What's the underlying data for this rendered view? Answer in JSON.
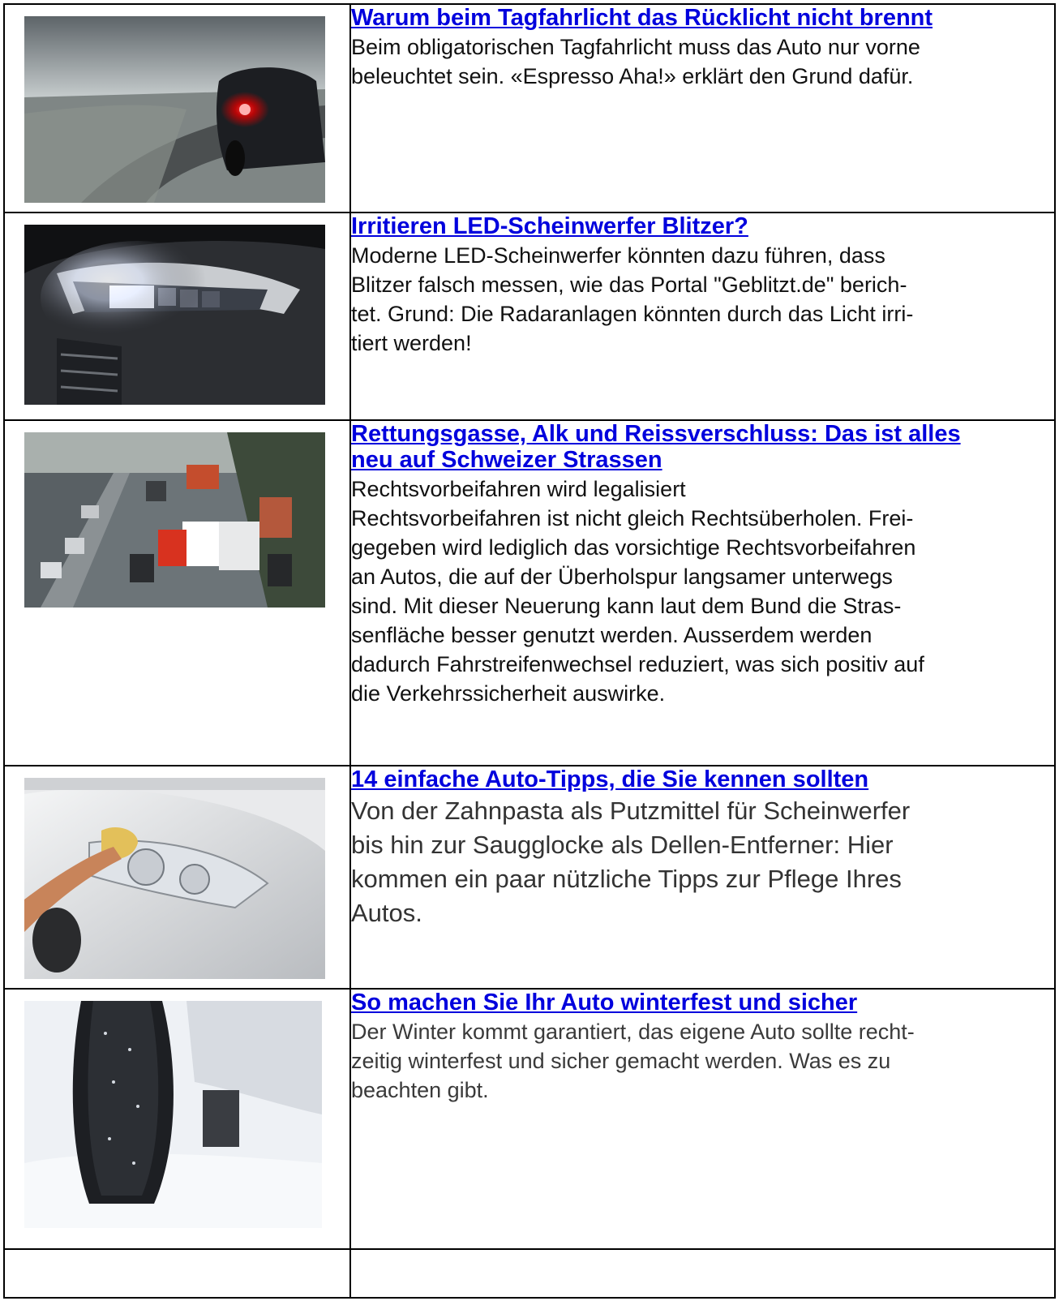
{
  "articles": [
    {
      "title": "Warum beim Tagfahrlicht das Rücklicht nicht brennt",
      "lines": [
        "Beim obligatorischen Tagfahrlicht muss das Auto nur vorne",
        "beleuchtet sein. «Espresso Aha!» erklärt den Grund dafür."
      ]
    },
    {
      "title": "Irritieren LED-Scheinwerfer Blitzer?",
      "lines": [
        "Moderne LED-Scheinwerfer könnten dazu führen, dass",
        "Blitzer falsch messen, wie das Portal \"Geblitzt.de\" berich-",
        "tet. Grund: Die Radaranlagen könnten durch das Licht irri-",
        "tiert werden!"
      ]
    },
    {
      "title_lines": [
        "Rettungsgasse, Alk und Reissverschluss: Das ist alles",
        "neu auf Schweizer Strassen"
      ],
      "lines": [
        "Rechtsvorbeifahren wird legalisiert",
        "Rechtsvorbeifahren ist nicht gleich Rechtsüberholen. Frei-",
        "gegeben wird lediglich das vorsichtige Rechtsvorbeifahren",
        "an Autos, die auf der Überholspur langsamer unterwegs",
        "sind. Mit dieser Neuerung kann laut dem Bund die Stras-",
        "senfläche besser genutzt werden. Ausserdem werden",
        "dadurch Fahrstreifenwechsel reduziert, was sich positiv auf",
        "die Verkehrssicherheit auswirke."
      ]
    },
    {
      "title": "14 einfache Auto-Tipps, die Sie kennen sollten",
      "lines": [
        "Von der Zahnpasta als Putzmittel für Scheinwerfer",
        "bis hin zur Saugglocke als Dellen-Entferner: Hier",
        "kommen ein paar nützliche Tipps zur Pflege Ihres",
        "Autos."
      ]
    },
    {
      "title": "So machen Sie Ihr Auto winterfest und sicher",
      "lines": [
        "Der Winter kommt garantiert, das eigene Auto sollte recht-",
        "zeitig winterfest und sicher gemacht werden. Was es zu",
        "beachten gibt."
      ]
    }
  ],
  "colors": {
    "link": "#0000dd",
    "border": "#000000"
  }
}
